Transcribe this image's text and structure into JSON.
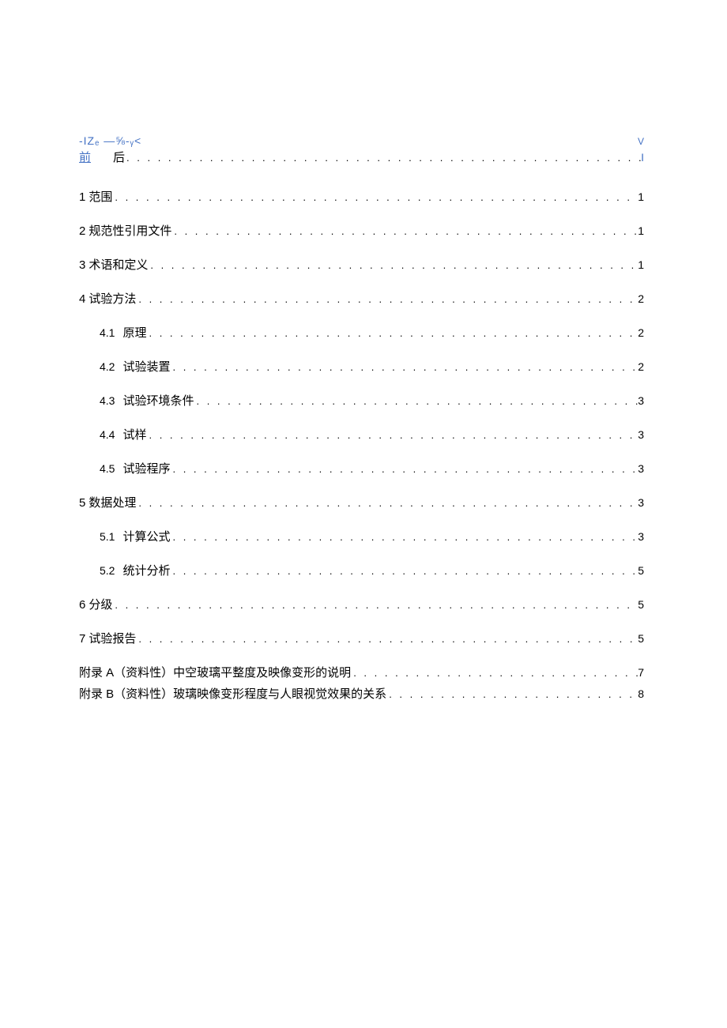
{
  "header": {
    "left_fragment": "-IZₑ    —⅝-ᵧ<",
    "right_fragment": "V"
  },
  "entry": {
    "front": "前",
    "back": "后",
    "page": "I"
  },
  "toc": [
    {
      "type": "main",
      "num": "1",
      "title": "范围",
      "page": "1"
    },
    {
      "type": "main",
      "num": "2",
      "title": "规范性引用文件",
      "page": "1"
    },
    {
      "type": "main",
      "num": "3",
      "title": "术语和定义",
      "page": "1"
    },
    {
      "type": "main",
      "num": "4",
      "title": "试验方法",
      "page": "2"
    },
    {
      "type": "sub",
      "num": "4.1",
      "title": "原理",
      "page": "2"
    },
    {
      "type": "sub",
      "num": "4.2",
      "title": "试验装置",
      "page": "2"
    },
    {
      "type": "sub",
      "num": "4.3",
      "title": "试验环境条件",
      "page": "3"
    },
    {
      "type": "sub",
      "num": "4.4",
      "title": "试样",
      "page": "3"
    },
    {
      "type": "sub",
      "num": "4.5",
      "title": "试验程序",
      "page": "3"
    },
    {
      "type": "main",
      "num": "5",
      "title": "数据处理",
      "page": "3"
    },
    {
      "type": "sub",
      "num": "5.1",
      "title": "计算公式",
      "page": "3"
    },
    {
      "type": "sub",
      "num": "5.2",
      "title": "统计分析",
      "page": "5"
    },
    {
      "type": "main",
      "num": "6",
      "title": "分级",
      "page": "5"
    },
    {
      "type": "main",
      "num": "7",
      "title": "试验报告",
      "page": "5"
    }
  ],
  "appendices": [
    {
      "title": "附录 A（资料性）中空玻璃平整度及映像变形的说明",
      "page": "7"
    },
    {
      "title": "附录 B（资料性）玻璃映像变形程度与人眼视觉效果的关系",
      "page": "8"
    }
  ],
  "dots": ". . . . . . . . . . . . . . . . . . . . . . . . . . . . . . . . . . . . . . . . . . . . . . . . . . . . . . . . . . . . . . . . . . . . . . . . . . . . . . . . . . . . . . . . . . . . . . . . . . . . . . . . . . . . . . . . . . . . . . . . . . . . . . . . ."
}
